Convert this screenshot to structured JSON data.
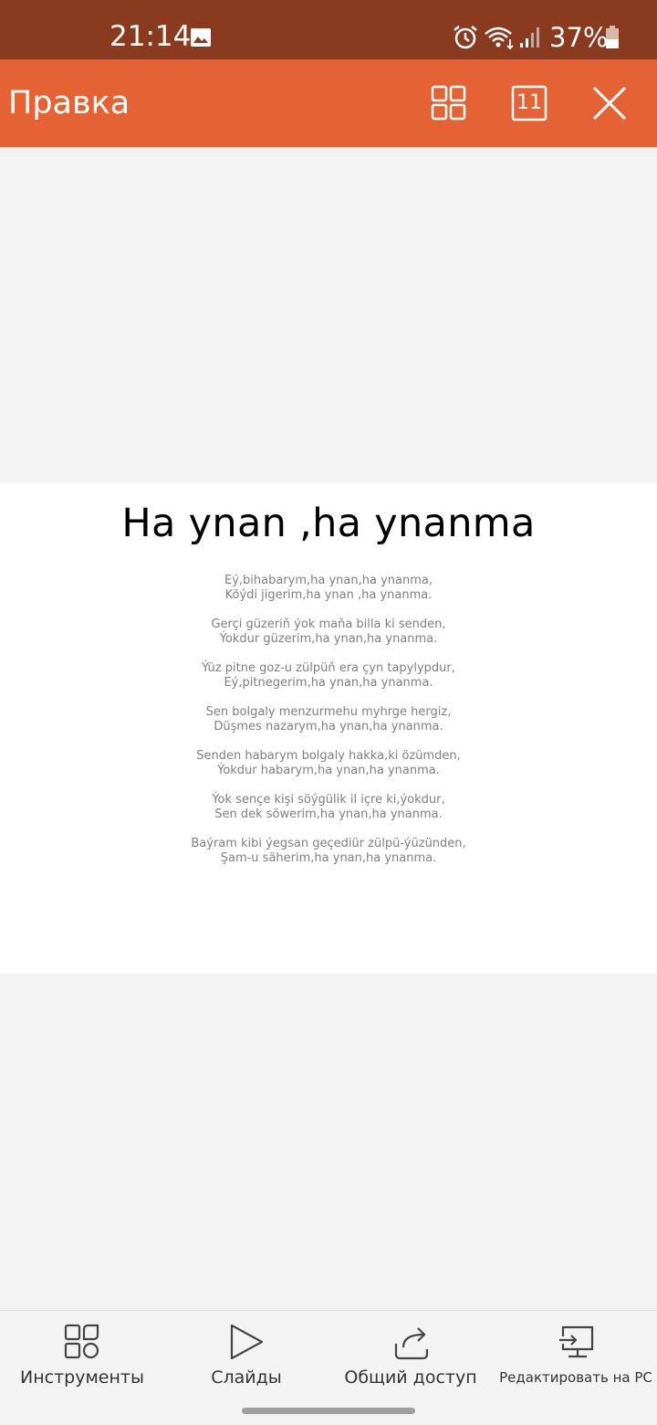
{
  "status_bar": {
    "time": "21:14",
    "battery": "37%",
    "icons": [
      "gallery-icon",
      "alarm-icon",
      "wifi-icon",
      "signal-icon",
      "battery-icon"
    ]
  },
  "toolbar": {
    "title": "Правка",
    "slide_number": "11",
    "icons": [
      "grid-icon",
      "slide-number-icon",
      "close-icon"
    ]
  },
  "slide": {
    "title": "Ha ynan ,ha ynanma",
    "stanzas": [
      [
        "Eý,bihabarym,ha ynan,ha ynanma,",
        "Köýdi jigerim,ha ynan ,ha ynanma."
      ],
      [
        "Gerçi güzeriň ýok maňa billa ki senden,",
        "Ýokdur güzerim,ha ynan,ha ynanma."
      ],
      [
        "Ýüz pitne goz-u zülpüň era çyn tapylypdur,",
        "Eý,pitnegerim,ha ynan,ha ynanma."
      ],
      [
        "Sen bolgaly menzurmehu myhrge hergiz,",
        "Düşmes nazarym,ha ynan,ha ynanma."
      ],
      [
        "Senden habarym bolgaly hakka,ki özümden,",
        "Ýokdur habarym,ha ynan,ha ynanma."
      ],
      [
        "Ýok senҫe kişi söýgülik il içre ki,ýokdur,",
        "Sen dek söwerim,ha ynan,ha ynanma."
      ],
      [
        "Baýram kibi ýegsan geçediür zülpü-ýüzünden,",
        "Şam-u säherim,ha ynan,ha ynanma."
      ]
    ]
  },
  "bottom_nav": {
    "tools": "Инструменты",
    "slides": "Слайды",
    "share": "Общий доступ",
    "edit_pc": "Редактировать на PC"
  },
  "colors": {
    "status_bar": "#8a3a1f",
    "toolbar": "#e46234",
    "canvas": "#f3f3f3",
    "slide": "#ffffff",
    "body_text": "#808080"
  }
}
